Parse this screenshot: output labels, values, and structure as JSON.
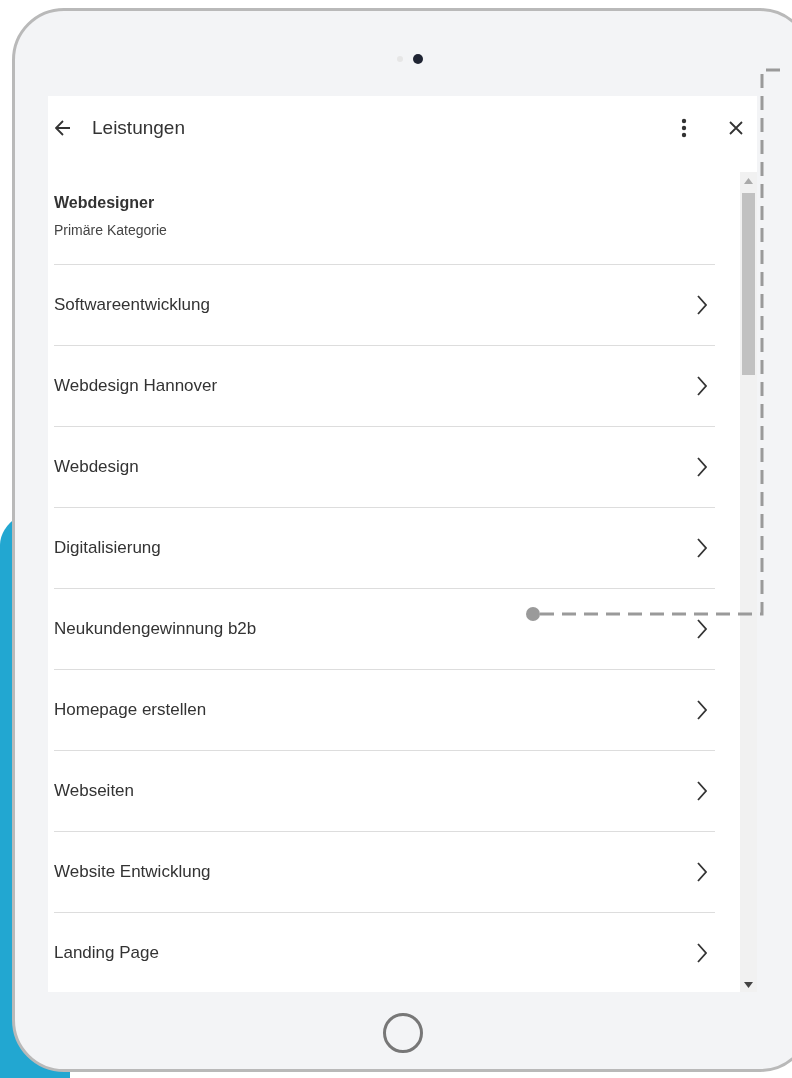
{
  "header": {
    "title": "Leistungen"
  },
  "primary": {
    "name": "Webdesigner",
    "subtitle": "Primäre Kategorie"
  },
  "items": [
    "Softwareentwicklung",
    "Webdesign Hannover",
    "Webdesign",
    "Digitalisierung",
    "Neukundengewinnung b2b",
    "Homepage erstellen",
    "Webseiten",
    "Website Entwicklung",
    "Landing Page"
  ]
}
